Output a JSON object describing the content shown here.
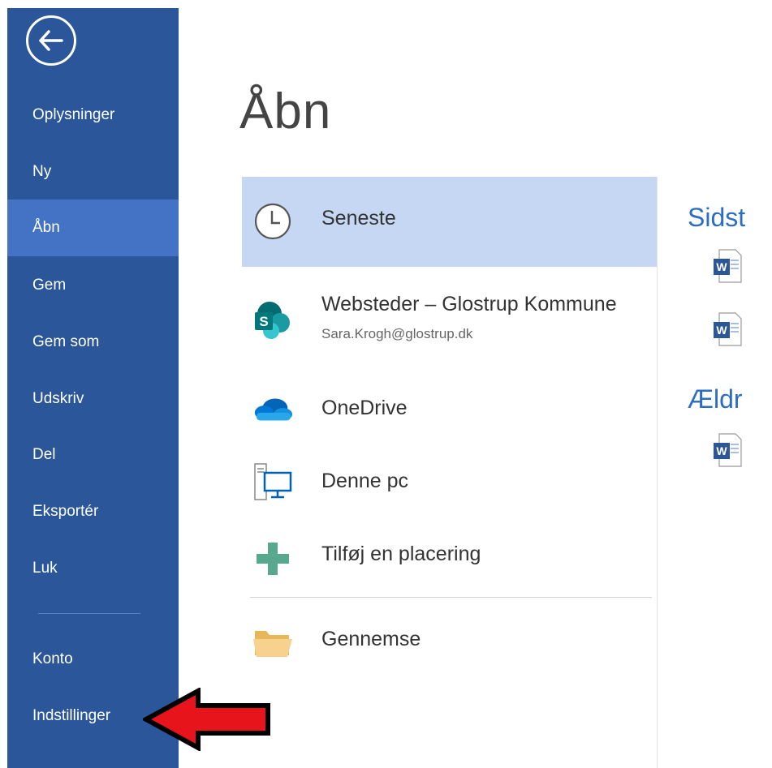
{
  "nav": {
    "items": [
      {
        "label": "Oplysninger"
      },
      {
        "label": "Ny"
      },
      {
        "label": "Åbn",
        "active": true
      },
      {
        "label": "Gem"
      },
      {
        "label": "Gem som"
      },
      {
        "label": "Udskriv"
      },
      {
        "label": "Del"
      },
      {
        "label": "Eksportér"
      },
      {
        "label": "Luk"
      }
    ],
    "bottom_items": [
      {
        "label": "Konto"
      },
      {
        "label": "Indstillinger"
      }
    ]
  },
  "main": {
    "title": "Åbn",
    "places": [
      {
        "label": "Seneste",
        "icon": "clock-icon",
        "active": true
      },
      {
        "label": "Websteder – Glostrup Kommune",
        "sublabel": "Sara.Krogh@glostrup.dk",
        "icon": "sharepoint-icon"
      },
      {
        "label": "OneDrive",
        "icon": "onedrive-cloud-icon"
      },
      {
        "label": "Denne pc",
        "icon": "computer-icon"
      },
      {
        "label": "Tilføj en placering",
        "icon": "plus-icon"
      },
      {
        "label": "Gennemse",
        "icon": "folder-icon"
      }
    ]
  },
  "recent": {
    "section1_header": "Sidst",
    "section2_header": "Ældr"
  },
  "colors": {
    "nav_bg": "#2b579a",
    "nav_active": "#4472c4",
    "place_active": "#c5d7f2",
    "accent_blue": "#2b6cc4",
    "annotation_arrow": "#e8141b"
  }
}
